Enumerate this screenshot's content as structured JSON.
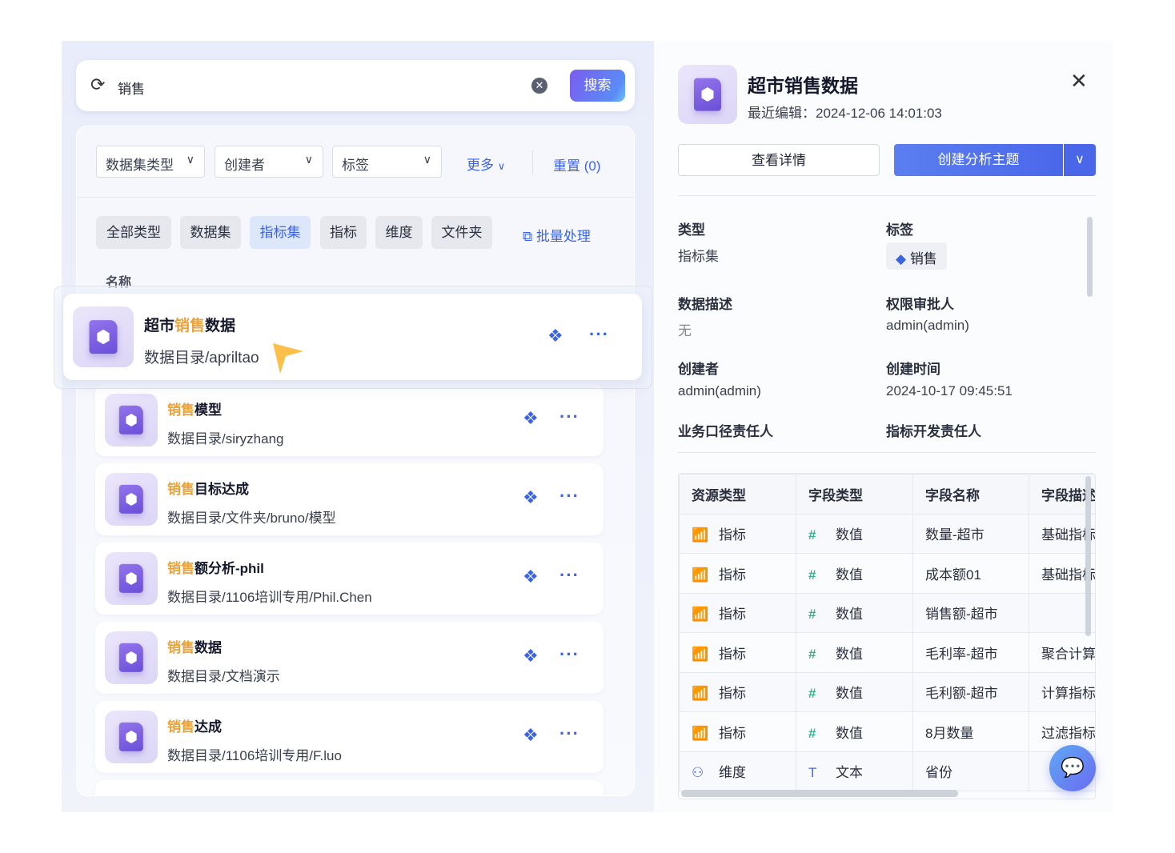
{
  "search": {
    "query": "销售",
    "button": "搜索"
  },
  "filters": {
    "dataset_type": "数据集类型",
    "creator": "创建者",
    "tag": "标签",
    "more": "更多",
    "reset": "重置 (0)"
  },
  "type_chips": [
    {
      "label": "全部类型"
    },
    {
      "label": "数据集"
    },
    {
      "label": "指标集",
      "active": true
    },
    {
      "label": "指标"
    },
    {
      "label": "维度"
    },
    {
      "label": "文件夹"
    }
  ],
  "batch": "批量处理",
  "list_header": "名称",
  "list": [
    {
      "pre": "超市",
      "hl": "销售",
      "post": "数据",
      "path": "数据目录/apriltao"
    },
    {
      "pre": "",
      "hl": "销售",
      "post": "模型",
      "path": "数据目录/siryzhang"
    },
    {
      "pre": "",
      "hl": "销售",
      "post": "目标达成",
      "path": "数据目录/文件夹/bruno/模型"
    },
    {
      "pre": "",
      "hl": "销售",
      "post": "额分析-phil",
      "path": "数据目录/1106培训专用/Phil.Chen"
    },
    {
      "pre": "",
      "hl": "销售",
      "post": "数据",
      "path": "数据目录/文档演示"
    },
    {
      "pre": "",
      "hl": "销售",
      "post": "达成",
      "path": "数据目录/1106培训专用/F.luo"
    }
  ],
  "detail": {
    "title": "超市销售数据",
    "edited": "最近编辑：2024-12-06 14:01:03",
    "view_btn": "查看详情",
    "create_btn": "创建分析主题",
    "type_label": "类型",
    "type_value": "指标集",
    "tag_label": "标签",
    "tag_value": "销售",
    "desc_label": "数据描述",
    "desc_value": "无",
    "approver_label": "权限审批人",
    "approver_value": "admin(admin)",
    "creator_label": "创建者",
    "creator_value": "admin(admin)",
    "created_label": "创建时间",
    "created_value": "2024-10-17 09:45:51",
    "biz_owner_label": "业务口径责任人",
    "dev_owner_label": "指标开发责任人"
  },
  "table": {
    "headers": [
      "资源类型",
      "字段类型",
      "字段名称",
      "字段描述"
    ],
    "rows": [
      [
        "指标",
        "数值",
        "数量-超市",
        "基础指标"
      ],
      [
        "指标",
        "数值",
        "成本额01",
        "基础指标"
      ],
      [
        "指标",
        "数值",
        "销售额-超市",
        ""
      ],
      [
        "指标",
        "数值",
        "毛利率-超市",
        "聚合计算"
      ],
      [
        "指标",
        "数值",
        "毛利额-超市",
        "计算指标"
      ],
      [
        "指标",
        "数值",
        "8月数量",
        "过滤指标"
      ],
      [
        "维度",
        "文本",
        "省份",
        ""
      ]
    ]
  },
  "colors": {
    "accent": "#3b63e6",
    "highlight": "#eaa33a",
    "metric_icon": "#3fae8c"
  }
}
